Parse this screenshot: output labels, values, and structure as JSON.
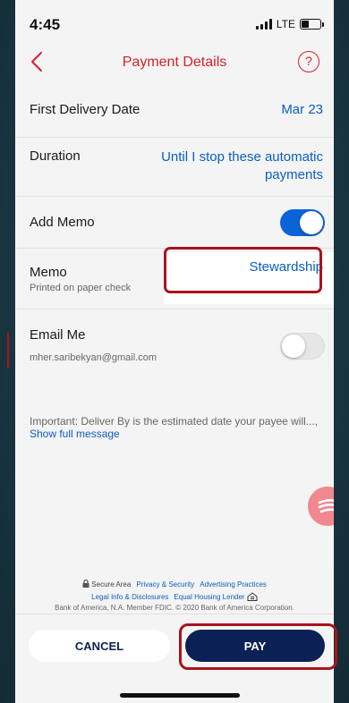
{
  "status_bar": {
    "time": "4:45",
    "network": "LTE"
  },
  "nav": {
    "title": "Payment Details",
    "help_symbol": "?"
  },
  "rows": {
    "first_delivery": {
      "label": "First Delivery Date",
      "value": "Mar 23"
    },
    "duration": {
      "label": "Duration",
      "value_line1": "Until I stop these automatic",
      "value_line2": "payments"
    },
    "add_memo": {
      "label": "Add Memo",
      "toggle": "on"
    },
    "memo": {
      "label": "Memo",
      "sublabel": "Printed on paper check",
      "value": "Stewardship"
    },
    "email_me": {
      "label": "Email Me",
      "sublabel": "mher.saribekyan@gmail.com",
      "toggle": "off"
    }
  },
  "important": {
    "text": "Important: Deliver By is the estimated date your payee will...,",
    "link": "Show full message"
  },
  "footer": {
    "secure_area": "Secure Area",
    "privacy": "Privacy & Security",
    "advertising": "Advertising Practices",
    "legal": "Legal Info & Disclosures",
    "equal_housing": "Equal Housing Lender",
    "legal_notice": "Bank of America, N.A. Member FDIC. © 2020 Bank of America Corporation."
  },
  "actions": {
    "cancel_label": "CANCEL",
    "pay_label": "PAY"
  },
  "colors": {
    "accent_red": "#d3202e",
    "link_blue": "#0a5ec0",
    "navy": "#0b2155",
    "toggle_on": "#0a64d8",
    "highlight": "#a8141c"
  },
  "icons": {
    "back": "chevron-left-icon",
    "help": "question-circle-icon",
    "lock": "lock-icon",
    "equal_housing": "house-icon",
    "fab": "chat-lines-icon"
  }
}
